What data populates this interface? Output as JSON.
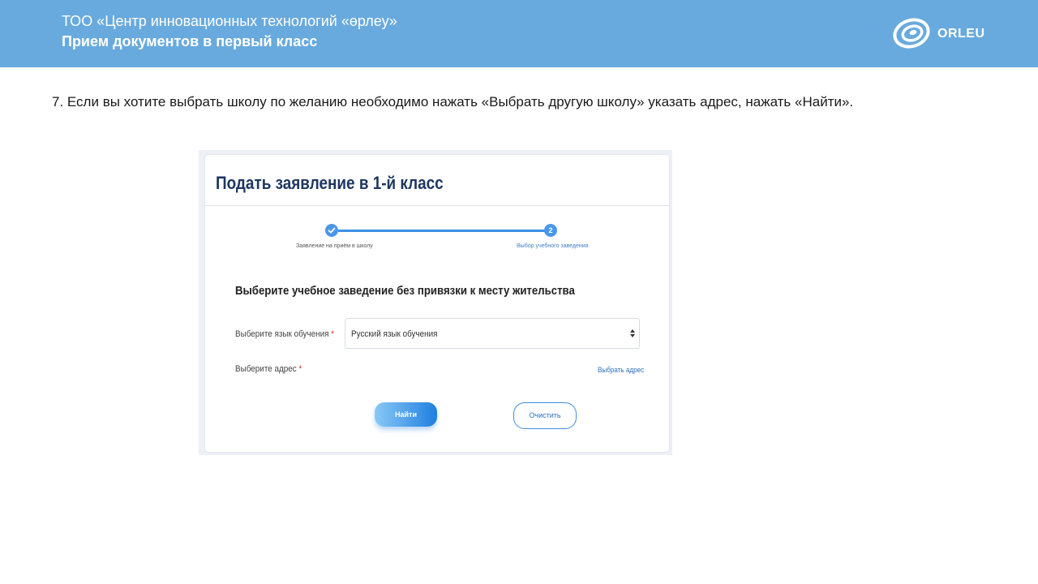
{
  "header": {
    "org_name": "ТОО «Центр инновационных технологий «өрлеу»",
    "subtitle": "Прием документов в первый класс",
    "logo_text": "ORLEU"
  },
  "instruction": "7. Если вы хотите выбрать школу по желанию необходимо нажать «Выбрать другую школу» указать адрес, нажать «Найти».",
  "form": {
    "title": "Подать заявление в 1-й класс",
    "steps": [
      {
        "number": "✓",
        "label": "Заявление на приём в школу",
        "status": "completed"
      },
      {
        "number": "2",
        "label": "Выбор учебного заведения",
        "status": "active"
      }
    ],
    "section_title": "Выберите учебное заведение без привязки к месту жительства",
    "language_label": "Выберите язык обучения",
    "language_value": "Русский язык обучения",
    "address_label": "Выберите адрес",
    "required_mark": "*",
    "choose_address_link": "Выбрать адрес",
    "find_button": "Найти",
    "clear_button": "Очистить"
  },
  "colors": {
    "header_bg": "#68aade",
    "title_color": "#1e3761",
    "accent": "#3f8fe4",
    "required": "#d9342b"
  },
  "icons": {
    "logo": "orleu-logo-icon",
    "step_done": "checkmark-icon",
    "select_arrows": "sort-arrows-icon"
  }
}
